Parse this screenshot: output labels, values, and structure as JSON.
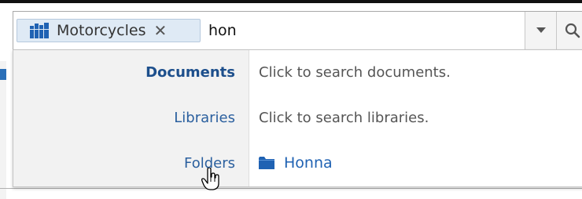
{
  "search": {
    "scope_chip": {
      "label": "Motorcycles",
      "icon": "library-icon",
      "remove_icon": "close-icon"
    },
    "query": "hon",
    "dropdown_icon": "chevron-down-icon",
    "search_icon": "search-icon"
  },
  "results": [
    {
      "category": "Documents",
      "hint": "Click to search documents."
    },
    {
      "category": "Libraries",
      "hint": "Click to search libraries."
    },
    {
      "category": "Folders",
      "item": {
        "name": "Honna",
        "icon": "folder-icon"
      }
    }
  ],
  "colors": {
    "accent_blue": "#1f62b3",
    "chip_background": "#dfeaf5",
    "panel_left_background": "#f2f2f2"
  },
  "cursor": "hand-pointer-icon"
}
